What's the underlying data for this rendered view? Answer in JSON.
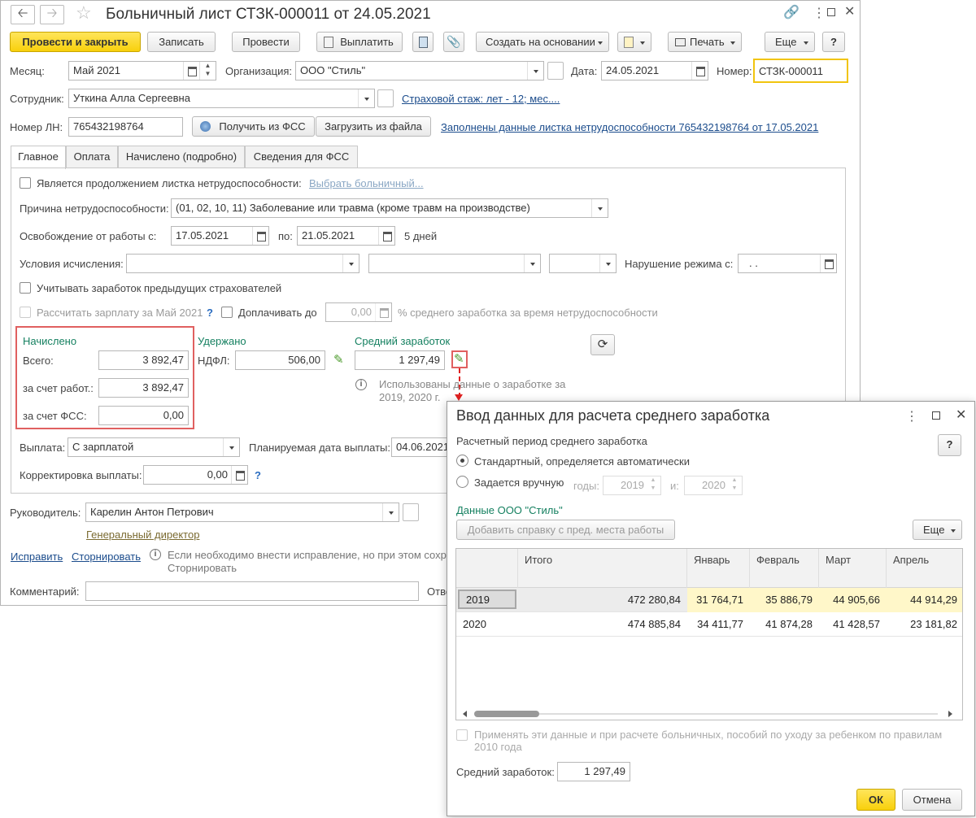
{
  "main": {
    "title": "Больничный лист СТЗК-000011 от 24.05.2021",
    "toolbar": {
      "post_close": "Провести и закрыть",
      "write": "Записать",
      "post": "Провести",
      "pay": "Выплатить",
      "create_based": "Создать на основании",
      "print": "Печать",
      "more": "Еще",
      "help": "?"
    },
    "month_label": "Месяц:",
    "month_value": "Май 2021",
    "org_label": "Организация:",
    "org_value": "ООО \"Стиль\"",
    "date_label": "Дата:",
    "date_value": "24.05.2021",
    "number_label": "Номер:",
    "number_value": "СТЗК-000011",
    "employee_label": "Сотрудник:",
    "employee_value": "Уткина Алла Сергеевна",
    "insurance_link": "Страховой стаж: лет - 12; мес....",
    "ln_label": "Номер ЛН:",
    "ln_value": "765432198764",
    "get_fss": "Получить из ФСС",
    "load_file": "Загрузить из файла",
    "filled_link": "Заполнены данные листка нетрудоспособности 765432198764 от 17.05.2021",
    "tabs": [
      "Главное",
      "Оплата",
      "Начислено (подробно)",
      "Сведения для ФСС"
    ],
    "continuation_label": "Является продолжением листка нетрудоспособности:",
    "choose_link": "Выбрать больничный...",
    "reason_label": "Причина нетрудоспособности:",
    "reason_value": "(01, 02, 10, 11) Заболевание или травма (кроме травм на производстве)",
    "release_label": "Освобождение от работы с:",
    "release_from": "17.05.2021",
    "to_label": "по:",
    "release_to": "21.05.2021",
    "days": "5 дней",
    "conditions_label": "Условия исчисления:",
    "violation_label": "Нарушение режима с:",
    "violation_value": " .  .",
    "prev_insurers": "Учитывать заработок предыдущих страхователей",
    "calc_salary": "Рассчитать зарплату за Май 2021",
    "calc_help": "?",
    "extra_pay": "Доплачивать до",
    "extra_value": "0,00",
    "extra_suffix": "% среднего заработка за время нетрудоспособности",
    "accrued_head": "Начислено",
    "total_label": "Всего:",
    "total_value": "3 892,47",
    "employer_label": "за счет работ.:",
    "employer_value": "3 892,47",
    "fss_label": "за счет ФСС:",
    "fss_value": "0,00",
    "withheld_head": "Удержано",
    "ndfl_label": "НДФЛ:",
    "ndfl_value": "506,00",
    "avg_head": "Средний заработок",
    "avg_value": "1 297,49",
    "avg_info": "Использованы данные о заработке за 2019,  2020 г.",
    "payout_label": "Выплата:",
    "payout_value": "С зарплатой",
    "plan_date_label": "Планируемая дата выплаты:",
    "plan_date_value": "04.06.2021",
    "correction_label": "Корректировка выплаты:",
    "correction_value": "0,00",
    "correction_help": "?",
    "manager_label": "Руководитель:",
    "manager_value": "Карелин Антон Петрович",
    "manager_position": "Генеральный директор",
    "fix_link": "Исправить",
    "reverse_link": "Сторнировать",
    "fix_info": "Если необходимо внести исправление, но при этом сохр",
    "fix_info2": "Сторнировать",
    "comment_label": "Комментарий:",
    "resp_label": "Отве"
  },
  "dialog": {
    "title": "Ввод данных для расчета среднего заработка",
    "period_label": "Расчетный период среднего заработка",
    "help": "?",
    "radio_standard": "Стандартный, определяется автоматически",
    "radio_manual": "Задается вручную",
    "years_label": "годы:",
    "year_from": "2019",
    "and_label": "и:",
    "year_to": "2020",
    "org_data": "Данные ООО \"Стиль\"",
    "add_btn": "Добавить справку с пред. места работы",
    "more": "Еще",
    "columns": [
      "Итого",
      "Январь",
      "Февраль",
      "Март",
      "Апрель"
    ],
    "rows": [
      {
        "year": "2019",
        "total": "472 280,84",
        "jan": "31 764,71",
        "feb": "35 886,79",
        "mar": "44 905,66",
        "apr": "44 914,29"
      },
      {
        "year": "2020",
        "total": "474 885,84",
        "jan": "34 411,77",
        "feb": "41 874,28",
        "mar": "41 428,57",
        "apr": "23 181,82"
      }
    ],
    "apply_label": "Применять эти данные и при расчете больничных, пособий по уходу за ребенком по правилам 2010 года",
    "avg_label": "Средний заработок:",
    "avg_value": "1 297,49",
    "ok": "ОК",
    "cancel": "Отмена"
  }
}
